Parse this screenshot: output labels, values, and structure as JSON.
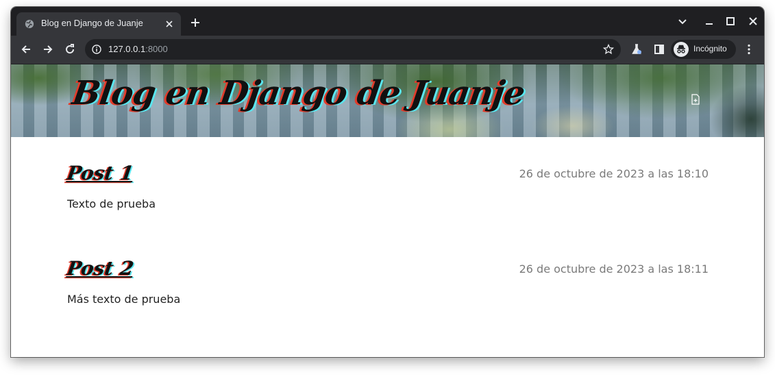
{
  "browser": {
    "tab": {
      "title": "Blog en Django de Juanje",
      "icon": "globe-icon"
    },
    "address": {
      "host": "127.0.0.1",
      "port": ":8000"
    },
    "profile_label": "Incógnito",
    "theme": {
      "frame": "#1f1f22",
      "toolbar": "#35363a",
      "omnibox": "#202124"
    }
  },
  "blog": {
    "title": "Blog en Django de Juanje",
    "new_post_icon": "file-plus-icon",
    "accent_colors": {
      "shadow_red": "#e23b2a",
      "shadow_cyan": "#59e6ef"
    }
  },
  "posts": [
    {
      "title": "Post 1",
      "date": "26 de octubre de 2023 a las 18:10",
      "text": "Texto de prueba"
    },
    {
      "title": "Post 2",
      "date": "26 de octubre de 2023 a las 18:11",
      "text": "Más texto de prueba"
    }
  ]
}
